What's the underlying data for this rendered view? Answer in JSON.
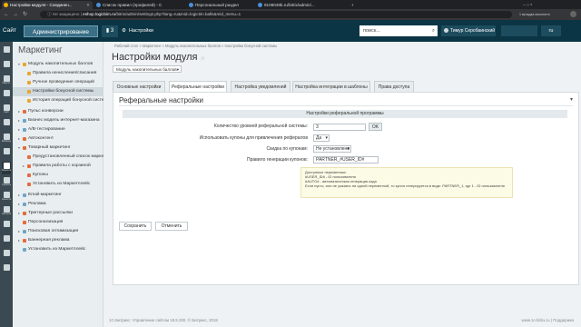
{
  "browser": {
    "tabs": [
      {
        "label": "Настройки модуля - Соединен..."
      },
      {
        "label": "Список правил (профилей) - С"
      },
      {
        "label": "Персональный раздел"
      },
      {
        "label": "9108049b.ru/bitrix/admin/..."
      }
    ],
    "url_warning": "Не защищено",
    "url_host": "eshop.logicbim.ru",
    "url_path": "/bitrix/admin/settings.php?lang=ru&mid=logictim.balls&mid_menu=1",
    "incognito_label": "1 вкладка инкогнито"
  },
  "header": {
    "site_label": "Сайт",
    "admin_label": "Администрирование",
    "notifications": "3",
    "settings_label": "Настройки",
    "search_placeholder": "поиск...",
    "user_name": "Тимур Серобаинский",
    "lang": "ru"
  },
  "rail": {
    "items": [
      "",
      "",
      "Маркет",
      "",
      "Сайт",
      "",
      "Вебформы",
      "",
      "",
      "Маркетинг",
      "",
      "",
      "Сервисы",
      "",
      "",
      "Аналитика",
      "",
      "",
      "Настройки"
    ]
  },
  "menu": {
    "title": "Маркетинг",
    "items": [
      {
        "label": "Модуль накопительных баллов",
        "level": 0,
        "arrow": "▾",
        "color": "#e8a530"
      },
      {
        "label": "Правила начисления/списания",
        "level": 1,
        "arrow": "",
        "color": "#e8a530"
      },
      {
        "label": "Ручное проведение операций",
        "level": 1,
        "arrow": "",
        "color": "#e8a530"
      },
      {
        "label": "Настройки бонусной системы",
        "level": 1,
        "arrow": "",
        "color": "#e8a530",
        "active": true
      },
      {
        "label": "История операций бонусной системы",
        "level": 1,
        "arrow": "",
        "color": "#e8a530"
      },
      {
        "label": "Пульс конверсии",
        "level": 0,
        "arrow": "▸",
        "color": "#e56b3a"
      },
      {
        "label": "Бизнес модель интернет-магазина",
        "level": 0,
        "arrow": "▸",
        "color": "#6fa6c6"
      },
      {
        "label": "A/B-тестирование",
        "level": 0,
        "arrow": "▸",
        "color": "#6fa6c6"
      },
      {
        "label": "Автоконтент",
        "level": 0,
        "arrow": "▸",
        "color": "#e56b3a"
      },
      {
        "label": "Товарный маркетинг",
        "level": 0,
        "arrow": "▾",
        "color": "#e56b3a"
      },
      {
        "label": "Предустановленный список маркетинга",
        "level": 1,
        "arrow": "",
        "color": "#e56b3a"
      },
      {
        "label": "Правила работы с корзиной",
        "level": 1,
        "arrow": "▸",
        "color": "#e56b3a"
      },
      {
        "label": "Купоны",
        "level": 1,
        "arrow": "",
        "color": "#e56b3a"
      },
      {
        "label": "Установить из Маркетплейс",
        "level": 1,
        "arrow": "",
        "color": "#e56b3a"
      },
      {
        "label": "Email-маркетинг",
        "level": 0,
        "arrow": "▸",
        "color": "#6fa6c6"
      },
      {
        "label": "Реклама",
        "level": 0,
        "arrow": "▸",
        "color": "#6fa6c6"
      },
      {
        "label": "Триггерные рассылки",
        "level": 0,
        "arrow": "▸",
        "color": "#e56b3a"
      },
      {
        "label": "Персонализация",
        "level": 0,
        "arrow": "",
        "color": "#e56b3a"
      },
      {
        "label": "Поисковая оптимизация",
        "level": 0,
        "arrow": "▸",
        "color": "#6fa6c6"
      },
      {
        "label": "Баннерная реклама",
        "level": 0,
        "arrow": "▸",
        "color": "#e56b3a"
      },
      {
        "label": "Установить из Маркетплейс",
        "level": 0,
        "arrow": "",
        "color": "#6fa6c6"
      }
    ]
  },
  "main": {
    "breadcrumb": "Рабочий стол  »  Маркетинг  »  Модуль накопительных баллов  »  Настройки бонусной системы",
    "title": "Настройки модуля",
    "module_select": "Модуль накопительных баллов",
    "tabs": [
      {
        "label": "Основные настройки"
      },
      {
        "label": "Реферальные настройки",
        "active": true
      },
      {
        "label": "Настройка уведомлений"
      },
      {
        "label": "Настройка интеграции в шаблоны"
      },
      {
        "label": "Права доступа"
      }
    ],
    "panel_title": "Реферальные настройки",
    "section_header": "Настройки реферальной программы",
    "fields": {
      "levels_label": "Количество уровней реферальной системы:",
      "levels_value": "3",
      "ok_label": "OK",
      "coupons_label": "Использовать купоны для привлечения рефералов",
      "coupons_value": "Да",
      "discount_label": "Скидка по купонам:",
      "discount_value": "Не установлено",
      "rule_label": "Правило генерации купонов:",
      "rule_value": "PARTNER_#USER_ID#"
    },
    "hint": {
      "line1": "Доступные переменные:",
      "line2": "#USER_ID# - ID пользователя",
      "line3": "#AUTO# - автоматическая генерация кода",
      "line4": "Если пусто, или не указано ни одной переменной, то купон генерируется в виде: PARTNER_1, где 1 - ID пользователя"
    },
    "save_label": "Сохранить",
    "cancel_label": "Отменить"
  },
  "footer": {
    "left": "1С-Битрикс: Управление сайтом 18.5.200. © Битрикс, 2018",
    "right": "www.1c-bitrix.ru  |  Поддержка"
  }
}
